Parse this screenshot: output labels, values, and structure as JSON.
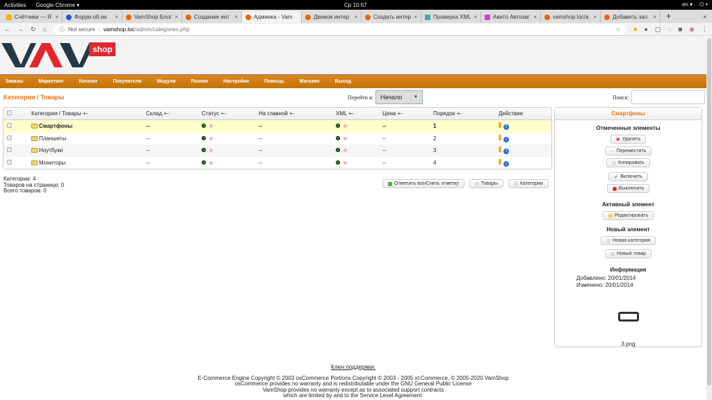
{
  "system": {
    "activities": "Activities",
    "app": "Google Chrome ▾",
    "clock": "Ср 10:57",
    "lang": "en ▾"
  },
  "tabs": [
    {
      "label": "Счётчики — Я"
    },
    {
      "label": "Форум об ин"
    },
    {
      "label": "VamShop Блог"
    },
    {
      "label": "Создание инт"
    },
    {
      "label": "Админка - Vam"
    },
    {
      "label": "Движок интер"
    },
    {
      "label": "Создать интер"
    },
    {
      "label": "Проверка XML"
    },
    {
      "label": "Авито Автозаг"
    },
    {
      "label": "vamshop.loc/a"
    },
    {
      "label": "Добавить зап"
    }
  ],
  "browser": {
    "not_secure": "Not secure",
    "url_host": "vamshop.loc",
    "url_path": "/admin/categories.php"
  },
  "logo": {
    "text": "VAM",
    "badge": "shop"
  },
  "nav": [
    "Заказы",
    "Маркетинг",
    "Каталог",
    "Покупатели",
    "Модули",
    "Разное",
    "Настройки",
    "Помощь",
    "Магазин",
    "Выход"
  ],
  "page_title": "Категории / Товары",
  "goto": {
    "label": "Перейти в:",
    "value": "Начало"
  },
  "search": {
    "label": "Поиск:",
    "value": ""
  },
  "table": {
    "headers": [
      "Категории / Товары +-",
      "Склад +-",
      "Статус +-",
      "На главной +-",
      "XML +-",
      "Цена +-",
      "Порядок +-",
      "Действие"
    ],
    "rows": [
      {
        "name": "Смартфоны",
        "stock": "--",
        "home": "--",
        "price": "--",
        "order": "1"
      },
      {
        "name": "Планшеты",
        "stock": "--",
        "home": "--",
        "price": "--",
        "order": "2"
      },
      {
        "name": "Ноутбуки",
        "stock": "--",
        "home": "--",
        "price": "--",
        "order": "3"
      },
      {
        "name": "Мониторы",
        "stock": "--",
        "home": "--",
        "price": "--",
        "order": "4"
      }
    ]
  },
  "stats": {
    "categories": "Категории: 4",
    "per_page": "Товаров на странице: 0",
    "total": "Всего товаров: 0"
  },
  "bottom_buttons": {
    "select_all": "Отметить все/Снять отметку",
    "products": "Товары",
    "categories": "Категории"
  },
  "panel": {
    "title": "Смартфоны",
    "marked": "Отмеченные элементы",
    "delete": "Удалить",
    "move": "Переместить",
    "copy": "Копировать",
    "enable": "Включить",
    "disable": "Выключить",
    "active": "Активный элемент",
    "edit": "Редактировать",
    "new": "Новый элемент",
    "new_category": "Новая категория",
    "new_product": "Новый товар",
    "info": "Информация",
    "added": "Добавлено: 20/01/2014",
    "modified": "Изменено: 20/01/2014",
    "image": "3.png"
  },
  "footer": {
    "key": "Ключ поддержки:",
    "lines": [
      "E-Commerce Engine Copyright © 2003 osCommerce Portions Copyright © 2003 - 2005 xt:Commerce, © 2005-2020 VamShop",
      "osCommerce provides no warranty and is redistributable under the GNU General Public License",
      "VamShop provides no warranty except as to associated support contracts",
      "which are limited by and to the Service Level Agreement."
    ]
  }
}
